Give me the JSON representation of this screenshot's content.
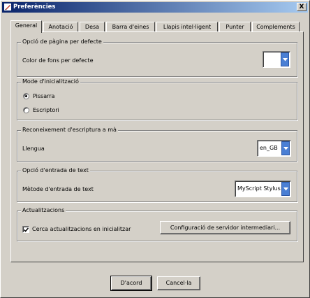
{
  "window": {
    "title": "Preferències",
    "close_symbol": "X"
  },
  "tabs": [
    {
      "label": "General",
      "active": true
    },
    {
      "label": "Anotació"
    },
    {
      "label": "Desa"
    },
    {
      "label": "Barra d'eines"
    },
    {
      "label": "Llapis intel·ligent"
    },
    {
      "label": "Punter"
    },
    {
      "label": "Complements"
    }
  ],
  "groups": {
    "page": {
      "title": "Opció de pàgina per defecte",
      "bg_label": "Color de fons per defecte",
      "bg_color": "#ffffff"
    },
    "init": {
      "title": "Mode d'inicialització",
      "options": [
        "Pissarra",
        "Escriptori"
      ],
      "selected": "Pissarra"
    },
    "handwriting": {
      "title": "Reconeixement d'escriptura a mà",
      "lang_label": "Llengua",
      "lang_value": "en_GB"
    },
    "text_input": {
      "title": "Opció d'entrada de text",
      "method_label": "Mètode d'entrada de text",
      "method_value": "MyScript Stylus"
    },
    "updates": {
      "title": "Actualitzacions",
      "check_label": "Cerca actualitzacions en inicialitzar",
      "checked": true,
      "proxy_button": "Configuració de servidor intermediari..."
    }
  },
  "footer": {
    "ok": "D'acord",
    "cancel": "Cancel·la"
  },
  "colors": {
    "accent": "#0a246a",
    "face": "#d4d0c8",
    "combo_button": "#4a7fd4"
  }
}
